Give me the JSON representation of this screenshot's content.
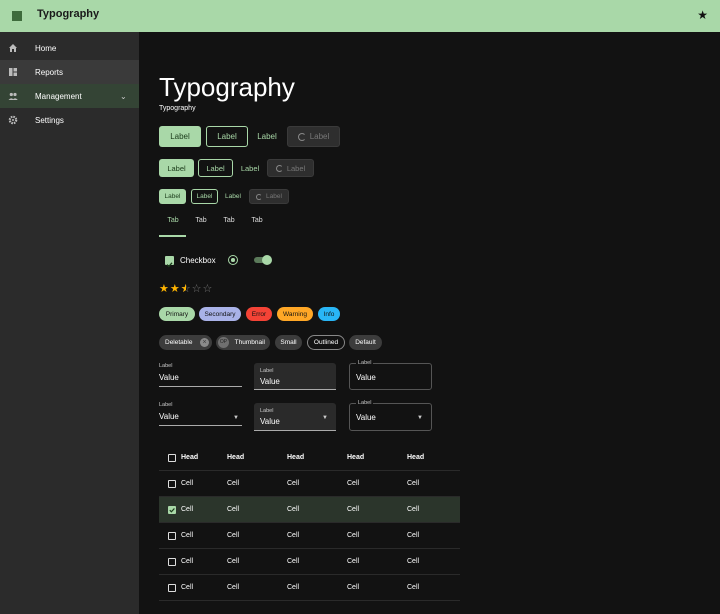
{
  "appbar": {
    "title": "Typography",
    "menu_icon": "menu-icon",
    "action_icon": "star-icon"
  },
  "sidebar": {
    "items": [
      {
        "label": "Home",
        "icon": "home-icon"
      },
      {
        "label": "Reports",
        "icon": "dashboard-icon"
      },
      {
        "label": "Management",
        "icon": "people-icon",
        "chevron": "⌄"
      },
      {
        "label": "Settings",
        "icon": "gear-icon"
      }
    ]
  },
  "main": {
    "heading": "Typography",
    "subtitle": "Typography",
    "buttons": {
      "large": [
        "Label",
        "Label",
        "Label",
        "Label"
      ],
      "medium": [
        "Label",
        "Label",
        "Label",
        "Label"
      ],
      "small": [
        "Label",
        "Label",
        "Label",
        "Label"
      ]
    },
    "tabs": [
      "Tab",
      "Tab",
      "Tab",
      "Tab"
    ],
    "checkbox_label": "Checkbox",
    "rating": {
      "value": 2.5,
      "max": 5
    },
    "chips_status": [
      "Primary",
      "Secondary",
      "Error",
      "Warning",
      "Info"
    ],
    "chips_variants": [
      "Deletable",
      "Thumbnail",
      "Small",
      "Outlined",
      "Default"
    ],
    "thumbnail_initials": "OP",
    "text_fields": [
      {
        "label": "Label",
        "value": "Value"
      },
      {
        "label": "Label",
        "value": "Value"
      },
      {
        "label": "Label",
        "value": "Value"
      }
    ],
    "select_fields": [
      {
        "label": "Label",
        "value": "Value"
      },
      {
        "label": "Label",
        "value": "Value"
      },
      {
        "label": "Label",
        "value": "Value"
      }
    ],
    "table": {
      "headers": [
        "Head",
        "Head",
        "Head",
        "Head",
        "Head"
      ],
      "rows": [
        [
          "Cell",
          "Cell",
          "Cell",
          "Cell",
          "Cell"
        ],
        [
          "Cell",
          "Cell",
          "Cell",
          "Cell",
          "Cell"
        ],
        [
          "Cell",
          "Cell",
          "Cell",
          "Cell",
          "Cell"
        ],
        [
          "Cell",
          "Cell",
          "Cell",
          "Cell",
          "Cell"
        ],
        [
          "Cell",
          "Cell",
          "Cell",
          "Cell",
          "Cell"
        ]
      ],
      "selected_row": 1
    }
  },
  "colors": {
    "primary": "#a9d8a8",
    "secondary": "#a9b2e8",
    "error": "#f44336",
    "warning": "#ffa726",
    "info": "#29b6f6"
  }
}
